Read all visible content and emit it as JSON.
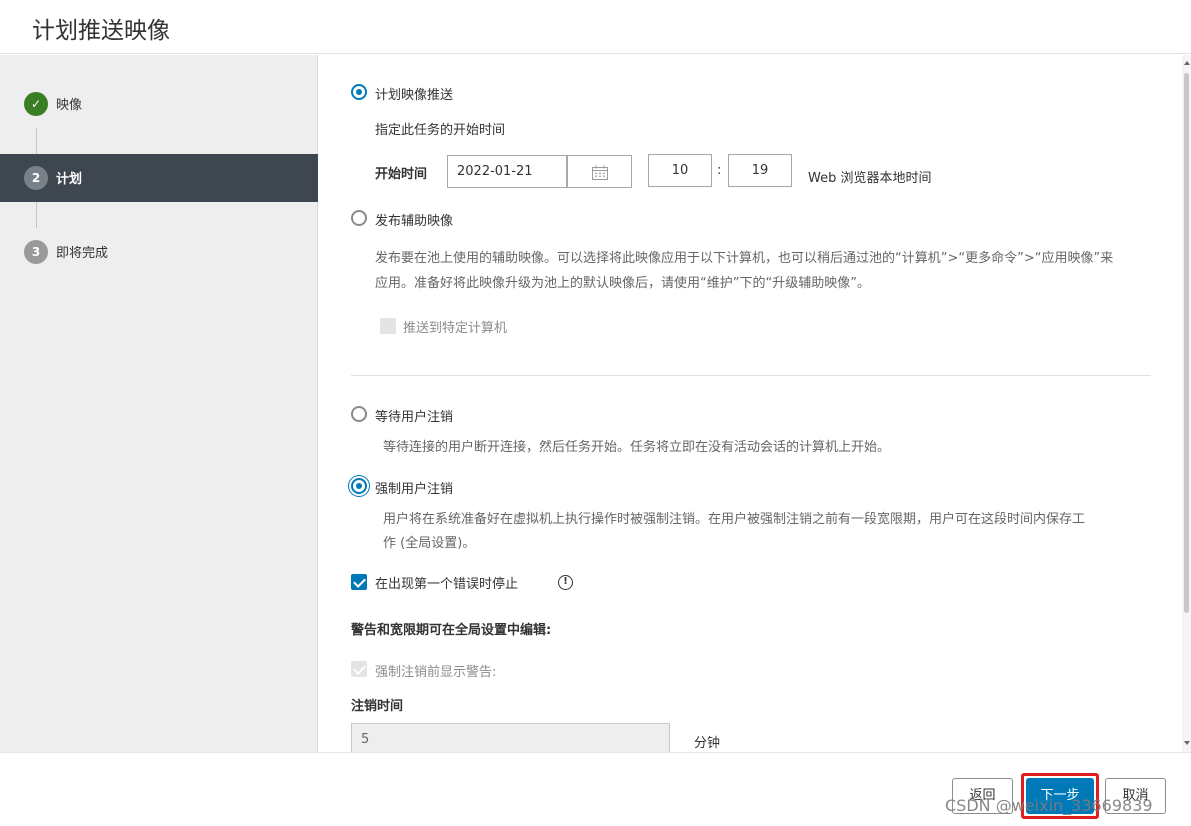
{
  "window": {
    "title": "计划推送映像"
  },
  "wizard": {
    "steps": [
      {
        "number": "✓",
        "label": "映像",
        "state": "done"
      },
      {
        "number": "2",
        "label": "计划",
        "state": "active"
      },
      {
        "number": "3",
        "label": "即将完成",
        "state": "todo"
      }
    ]
  },
  "schedule": {
    "option_schedule_label": "计划映像推送",
    "option_schedule_desc": "指定此任务的开始时间",
    "start_time_label": "开始时间",
    "date_value": "2022-01-21",
    "hour_value": "10",
    "time_separator": ":",
    "minute_value": "19",
    "timezone_note": "Web 浏览器本地时间",
    "option_secondary_label": "发布辅助映像",
    "option_secondary_desc_line1": "发布要在池上使用的辅助映像。可以选择将此映像应用于以下计算机，也可以稍后通过池的“计算机”>“更多命令”>“应用映像”来",
    "option_secondary_desc_line2": "应用。准备好将此映像升级为池上的默认映像后，请使用“维护”下的“升级辅助映像”。",
    "push_specific_label": "推送到特定计算机"
  },
  "logoff": {
    "wait_label": "等待用户注销",
    "wait_desc": "等待连接的用户断开连接，然后任务开始。任务将立即在没有活动会话的计算机上开始。",
    "force_label": "强制用户注销",
    "force_desc_line1": "用户将在系统准备好在虚拟机上执行操作时被强制注销。在用户被强制注销之前有一段宽限期，用户可在这段时间内保存工",
    "force_desc_line2": "作 (全局设置)。",
    "stop_on_error_label": "在出现第一个错误时停止",
    "info_icon_glyph": "!",
    "global_settings_note": "警告和宽限期可在全局设置中编辑:",
    "show_warning_label": "强制注销前显示警告:",
    "logoff_time_label": "注销时间",
    "logoff_time_value": "5",
    "logoff_time_unit": "分钟"
  },
  "footer": {
    "back_label": "返回",
    "next_label": "下一步",
    "cancel_label": "取消"
  },
  "watermark": "CSDN @weixin_33669839",
  "colors": {
    "accent": "#0079b8",
    "sidebar_active": "#3e4650",
    "step_done": "#3b7d23",
    "highlight": "#e21d1d"
  }
}
